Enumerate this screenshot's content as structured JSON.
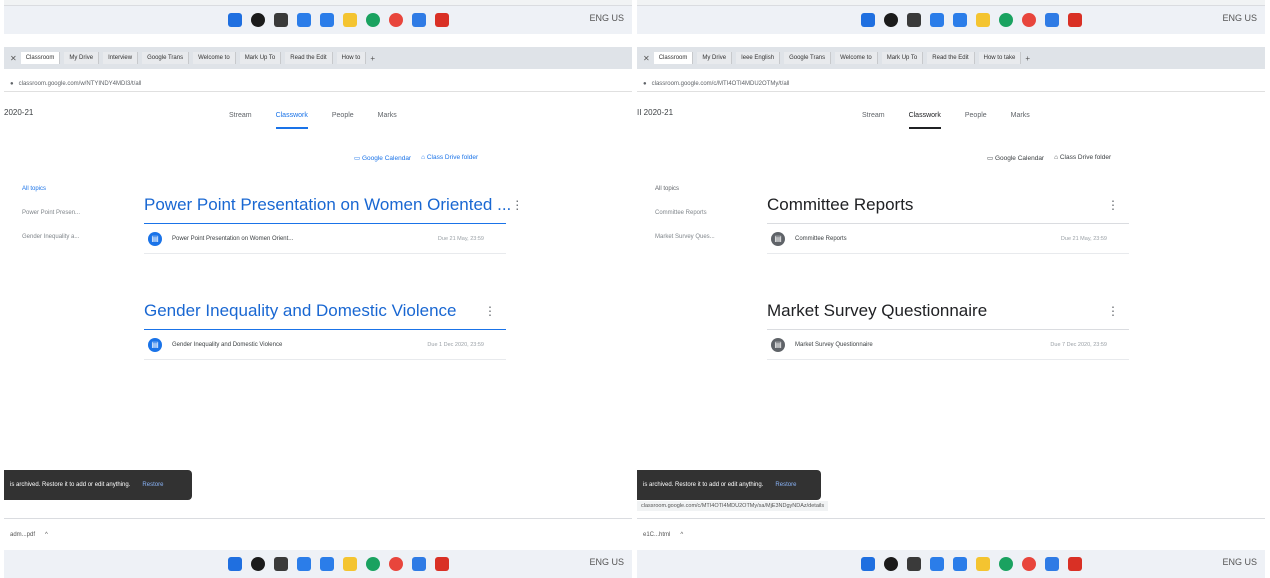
{
  "left": {
    "tray": "ENG US",
    "tabs": [
      "Classroom",
      "My Drive",
      "Interview",
      "Google Trans",
      "Welcome to",
      "Mark Up To",
      "Read the Edit",
      "How to"
    ],
    "url": "classroom.google.com/w/NTYINDY4MDI3/t/all",
    "class_name": "2020-21",
    "nav": {
      "stream": "Stream",
      "classwork": "Classwork",
      "people": "People",
      "marks": "Marks"
    },
    "calendar_link": "Google Calendar",
    "drive_link": "Class Drive folder",
    "topics": [
      "All topics",
      "Power Point Presen...",
      "Gender Inequality a..."
    ],
    "sections": [
      {
        "title": "Power Point Presentation on Women Oriented ...",
        "item": "Power Point Presentation on Women Orient...",
        "due": "Due 21 May, 23:59"
      },
      {
        "title": "Gender Inequality and Domestic Violence",
        "item": "Gender Inequality and Domestic Violence",
        "due": "Due 1 Dec 2020, 23:59"
      }
    ],
    "snackbar": {
      "text": "is archived. Restore it to add or edit anything.",
      "action": "Restore"
    },
    "download": "adm...pdf"
  },
  "right": {
    "tray": "ENG US",
    "tabs": [
      "Classroom",
      "My Drive",
      "Ieee English",
      "Google Trans",
      "Welcome to",
      "Mark Up To",
      "Read the Edit",
      "How to take"
    ],
    "url": "classroom.google.com/c/MTI4OTI4MDU2OTMy/t/all",
    "class_name": "II 2020-21",
    "nav": {
      "stream": "Stream",
      "classwork": "Classwork",
      "people": "People",
      "marks": "Marks"
    },
    "calendar_link": "Google Calendar",
    "drive_link": "Class Drive folder",
    "topics": [
      "All topics",
      "Committee Reports",
      "Market Survey Ques..."
    ],
    "sections": [
      {
        "title": "Committee Reports",
        "item": "Committee Reports",
        "due": "Due 21 May, 23:59"
      },
      {
        "title": "Market Survey Questionnaire",
        "item": "Market Survey Questionnaire",
        "due": "Due 7 Dec 2020, 23:59"
      }
    ],
    "snackbar": {
      "text": "is archived. Restore it to add or edit anything.",
      "action": "Restore"
    },
    "status_url": "classroom.google.com/c/MTI4OTI4MDU2OTMy/sa/MjE3NDgyNDAz/details",
    "download": "e1C...html"
  },
  "taskbar_icon_colors": [
    "#1f6fe0",
    "#1b1b1b",
    "#3a3a3a",
    "#2b7de9",
    "#2b7de9",
    "#f4c430",
    "#1aa260",
    "#e8453c",
    "#2f7be5",
    "#d93025"
  ]
}
